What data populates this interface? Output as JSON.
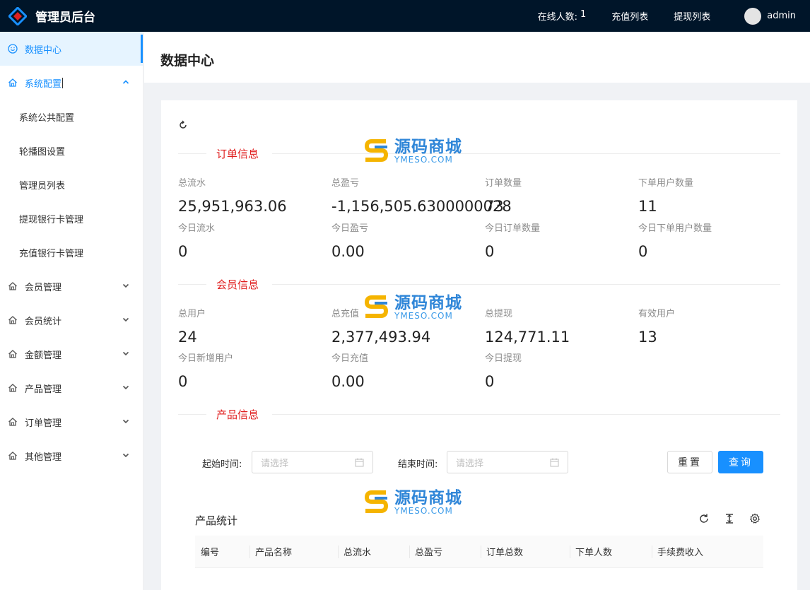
{
  "app": {
    "title": "管理员后台"
  },
  "topbar": {
    "online_label": "在线人数:",
    "online_count": "1",
    "recharge_list": "充值列表",
    "withdraw_list": "提现列表",
    "username": "admin"
  },
  "sidebar": {
    "items": [
      {
        "label": "数据中心"
      },
      {
        "label": "系统配置"
      },
      {
        "label": "会员管理"
      },
      {
        "label": "会员统计"
      },
      {
        "label": "金额管理"
      },
      {
        "label": "产品管理"
      },
      {
        "label": "订单管理"
      },
      {
        "label": "其他管理"
      }
    ],
    "sub_items": [
      {
        "label": "系统公共配置"
      },
      {
        "label": "轮播图设置"
      },
      {
        "label": "管理员列表"
      },
      {
        "label": "提现银行卡管理"
      },
      {
        "label": "充值银行卡管理"
      }
    ]
  },
  "page": {
    "title": "数据中心"
  },
  "sections": {
    "orders": {
      "title": "订单信息",
      "stats": [
        {
          "label": "总流水",
          "value": "25,951,963.06"
        },
        {
          "label": "总盈亏",
          "value": "-1,156,505.6300000028"
        },
        {
          "label": "订单数量",
          "value": "73"
        },
        {
          "label": "下单用户数量",
          "value": "11"
        },
        {
          "label": "今日流水",
          "value": "0"
        },
        {
          "label": "今日盈亏",
          "value": "0.00"
        },
        {
          "label": "今日订单数量",
          "value": "0"
        },
        {
          "label": "今日下单用户数量",
          "value": "0"
        }
      ]
    },
    "members": {
      "title": "会员信息",
      "stats": [
        {
          "label": "总用户",
          "value": "24"
        },
        {
          "label": "总充值",
          "value": "2,377,493.94"
        },
        {
          "label": "总提现",
          "value": "124,771.11"
        },
        {
          "label": "有效用户",
          "value": "13"
        },
        {
          "label": "今日新增用户",
          "value": "0"
        },
        {
          "label": "今日充值",
          "value": "0.00"
        },
        {
          "label": "今日提现",
          "value": "0"
        }
      ]
    },
    "products": {
      "title": "产品信息"
    }
  },
  "filters": {
    "start_label": "起始时间:",
    "end_label": "结束时间:",
    "placeholder": "请选择",
    "reset": "重置",
    "query": "查询"
  },
  "table": {
    "title": "产品统计",
    "columns": [
      "编号",
      "产品名称",
      "总流水",
      "总盈亏",
      "订单总数",
      "下单人数",
      "手续费收入"
    ]
  },
  "watermark": {
    "cn": "源码商城",
    "en": "YMESO.COM"
  }
}
